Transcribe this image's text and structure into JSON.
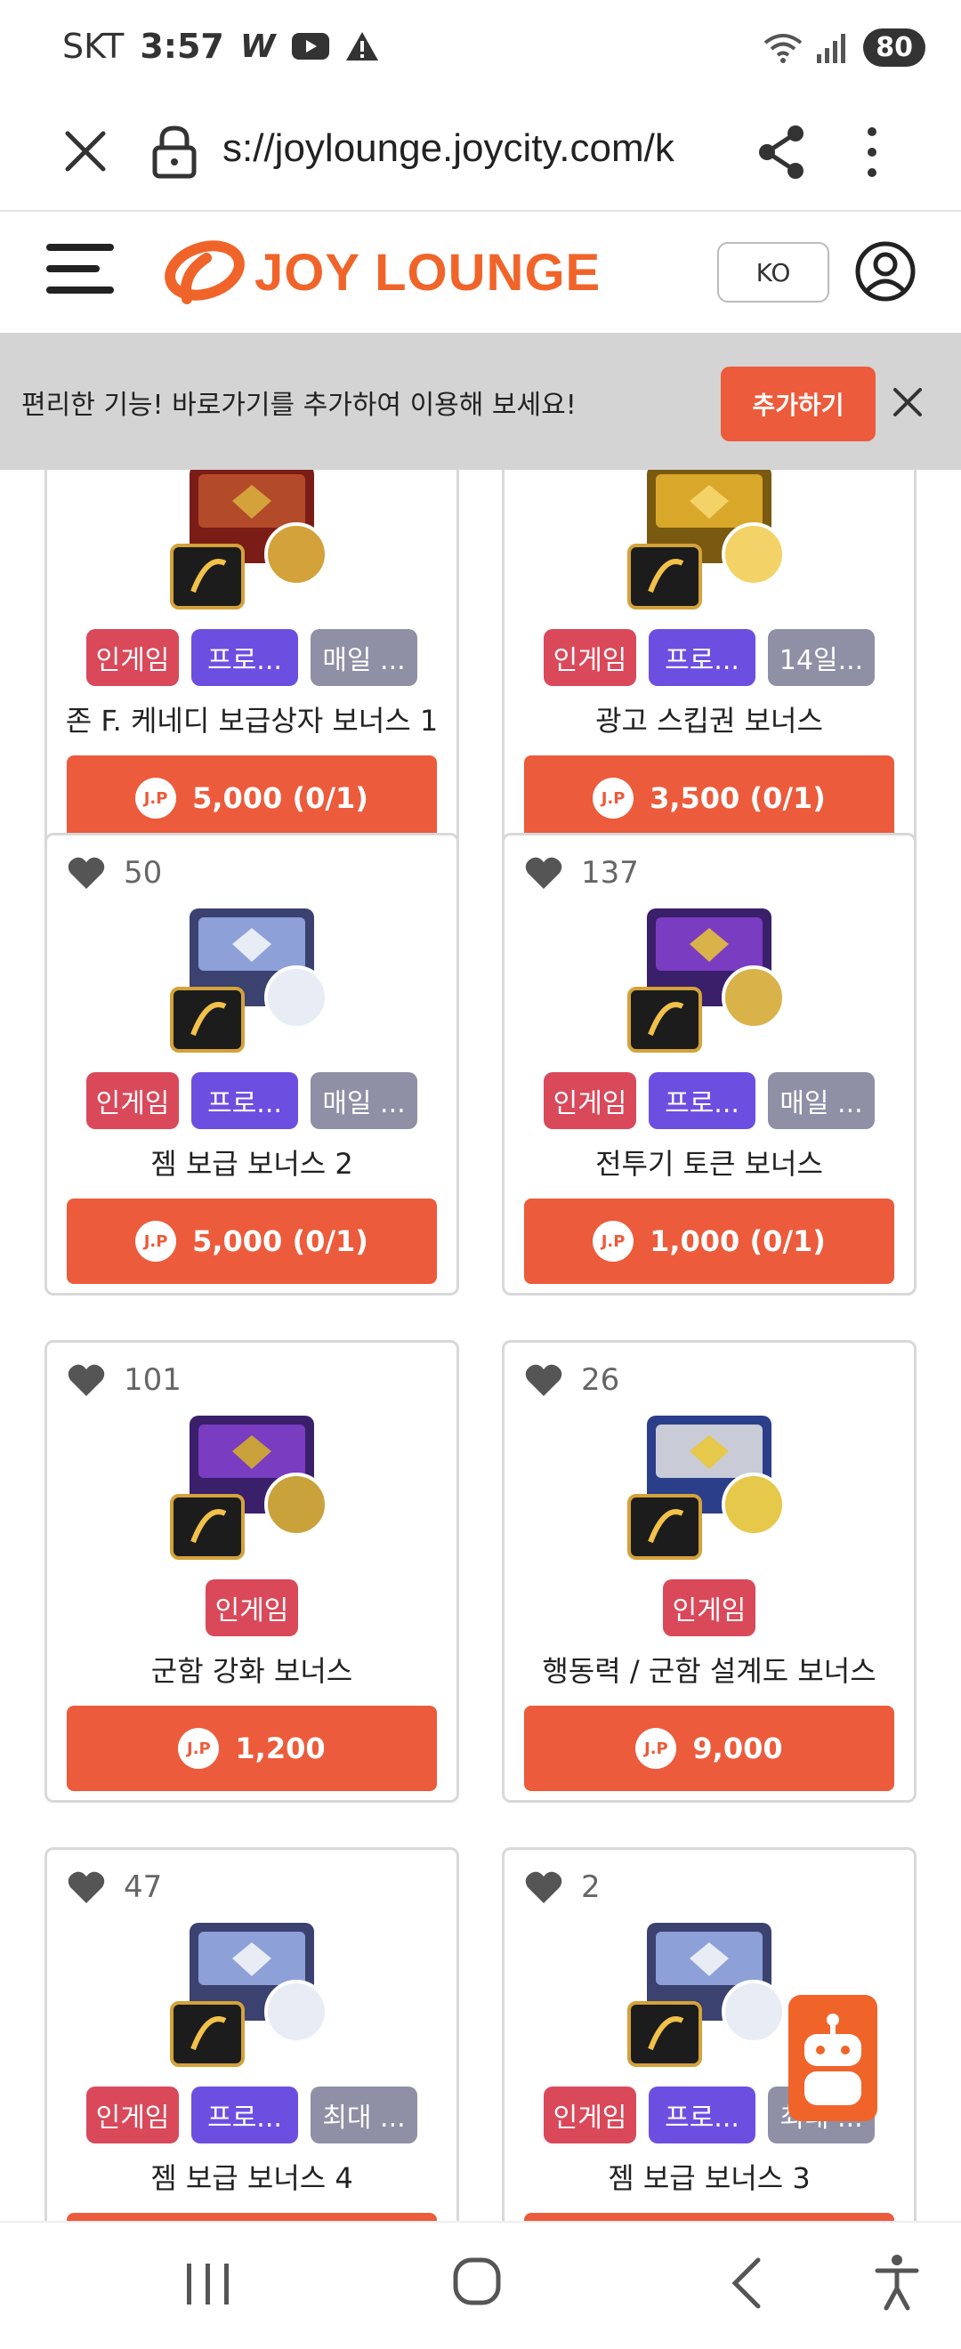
{
  "status_bar": {
    "carrier": "SKT",
    "time": "3:57",
    "w_badge": "W",
    "battery": "80",
    "icons": [
      "youtube-icon",
      "warning-icon",
      "wifi-icon",
      "signal-icon"
    ]
  },
  "browser": {
    "url": "s://joylounge.joycity.com/k",
    "icons": [
      "close-icon",
      "lock-icon",
      "share-icon",
      "more-vertical-icon"
    ]
  },
  "header": {
    "logo_text": "JOY LOUNGE",
    "lang": "KO",
    "brand_color": "#f0642a"
  },
  "banner": {
    "message": "편리한 기능! 바로가기를 추가하여 이용해 보세요!",
    "add_label": "추가하기"
  },
  "products": [
    {
      "likes": "",
      "tags": [
        "인게임",
        "프로...",
        "매일 ..."
      ],
      "title": "존 F. 케네디 보급상자 보너스 1",
      "price": "5,000 (0/1)",
      "thumb": "red-gold-crate"
    },
    {
      "likes": "",
      "tags": [
        "인게임",
        "프로...",
        "14일..."
      ],
      "title": "광고 스킵권 보너스",
      "price": "3,500 (0/1)",
      "thumb": "gold-bars"
    },
    {
      "likes": "50",
      "tags": [
        "인게임",
        "프로...",
        "매일 ..."
      ],
      "title": "젬 보급 보너스 2",
      "price": "5,000 (0/1)",
      "thumb": "diamond-crate"
    },
    {
      "likes": "137",
      "tags": [
        "인게임",
        "프로...",
        "매일 ..."
      ],
      "title": "전투기 토큰 보너스",
      "price": "1,000 (0/1)",
      "thumb": "purple-case-gold"
    },
    {
      "likes": "101",
      "tags": [
        "인게임"
      ],
      "title": "군함 강화 보너스",
      "price": "1,200",
      "thumb": "purple-case-anchor"
    },
    {
      "likes": "26",
      "tags": [
        "인게임"
      ],
      "title": "행동력 / 군함 설계도 보너스",
      "price": "9,000",
      "thumb": "medal"
    },
    {
      "likes": "47",
      "tags": [
        "인게임",
        "프로...",
        "최대 ..."
      ],
      "title": "젬 보급 보너스 4",
      "price": "",
      "thumb": "diamond-crate"
    },
    {
      "likes": "2",
      "tags": [
        "인게임",
        "프로...",
        "최대 ..."
      ],
      "title": "젬 보급 보너스 3",
      "price": "",
      "thumb": "diamond-crate"
    }
  ],
  "jp_label": "J.P",
  "colors": {
    "tag_ingame": "#d9495a",
    "tag_promo": "#6c4fe0",
    "tag_period": "#8f8fa6",
    "button": "#ec5b3b"
  }
}
